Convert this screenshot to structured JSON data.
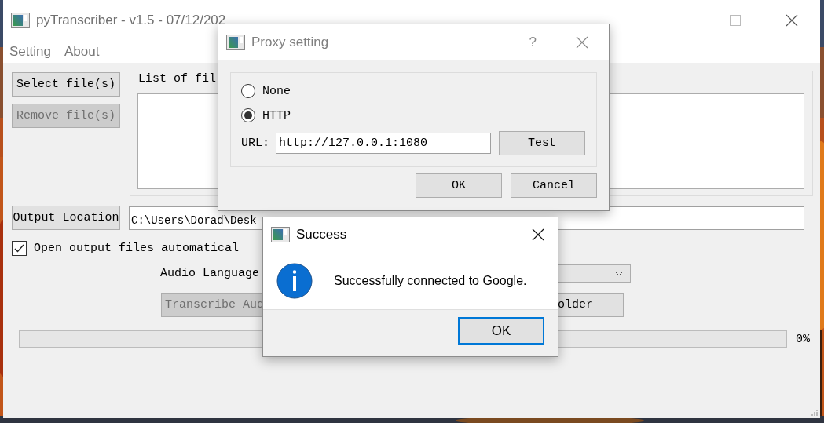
{
  "main_window": {
    "title": "pyTranscriber - v1.5 - 07/12/202",
    "menu": [
      {
        "label": "Setting"
      },
      {
        "label": "About"
      }
    ],
    "select_button": "Select file(s)",
    "remove_button": {
      "label": "Remove file(s)",
      "disabled": true
    },
    "file_list": {
      "title": "List of fil"
    },
    "output_location": {
      "button": "Output Location",
      "value": "C:\\Users\\Dorad\\Desk"
    },
    "open_output": {
      "label": "Open output files automatical",
      "checked": true
    },
    "audio_language": {
      "label": "Audio Language:"
    },
    "buttons": [
      {
        "label": "Transcribe Aud",
        "disabled": true
      },
      {
        "label": "older",
        "disabled": false
      }
    ],
    "progress": {
      "level": 0,
      "reading": "0%"
    }
  },
  "proxy_dialog": {
    "title": "Proxy setting",
    "help": "?",
    "options": [
      {
        "label": "None",
        "selected": false
      },
      {
        "label": "HTTP",
        "selected": true
      }
    ],
    "url_label": "URL:",
    "url": "http://127.0.0.1:1080",
    "test_button": "Test",
    "buttons": [
      "OK",
      "Cancel"
    ]
  },
  "success_dialog": {
    "title": "Success",
    "message": "Successfully connected to Google.",
    "button": "OK"
  }
}
